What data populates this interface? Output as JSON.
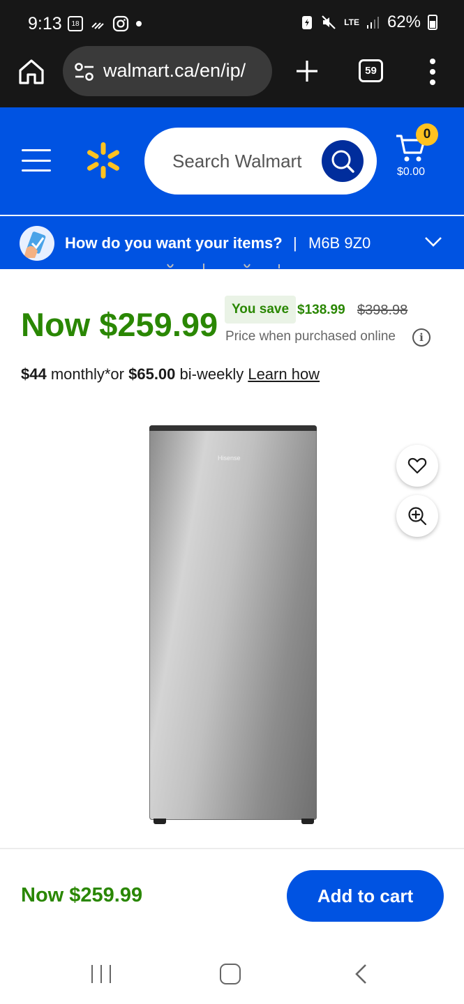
{
  "status_bar": {
    "time": "9:13",
    "calendar_day": "18",
    "network": "LTE",
    "battery": "62%"
  },
  "browser": {
    "url": "walmart.ca/en/ip/",
    "tab_count": "59"
  },
  "header": {
    "search_placeholder": "Search Walmart",
    "cart_count": "0",
    "cart_total": "$0.00",
    "brand_colors": {
      "blue": "#0053e2",
      "yellow": "#ffc220"
    }
  },
  "delivery": {
    "question": "How do you want your items?",
    "separator": "|",
    "postal_code": "M6B 9Z0"
  },
  "pricing": {
    "now_price": "Now $259.99",
    "you_save_label": "You save",
    "save_amount": "$138.99",
    "was_price": "$398.98",
    "price_note": "Price when purchased online",
    "price_color": "#2a8703"
  },
  "financing": {
    "monthly_amount": "$44",
    "monthly_text": " monthly*or ",
    "biweekly_amount": "$65.00",
    "biweekly_text": " bi-weekly ",
    "learn_link": "Learn how"
  },
  "product": {
    "brand_on_image": "Hisense"
  },
  "footer": {
    "price": "Now $259.99",
    "add_to_cart": "Add to cart"
  }
}
